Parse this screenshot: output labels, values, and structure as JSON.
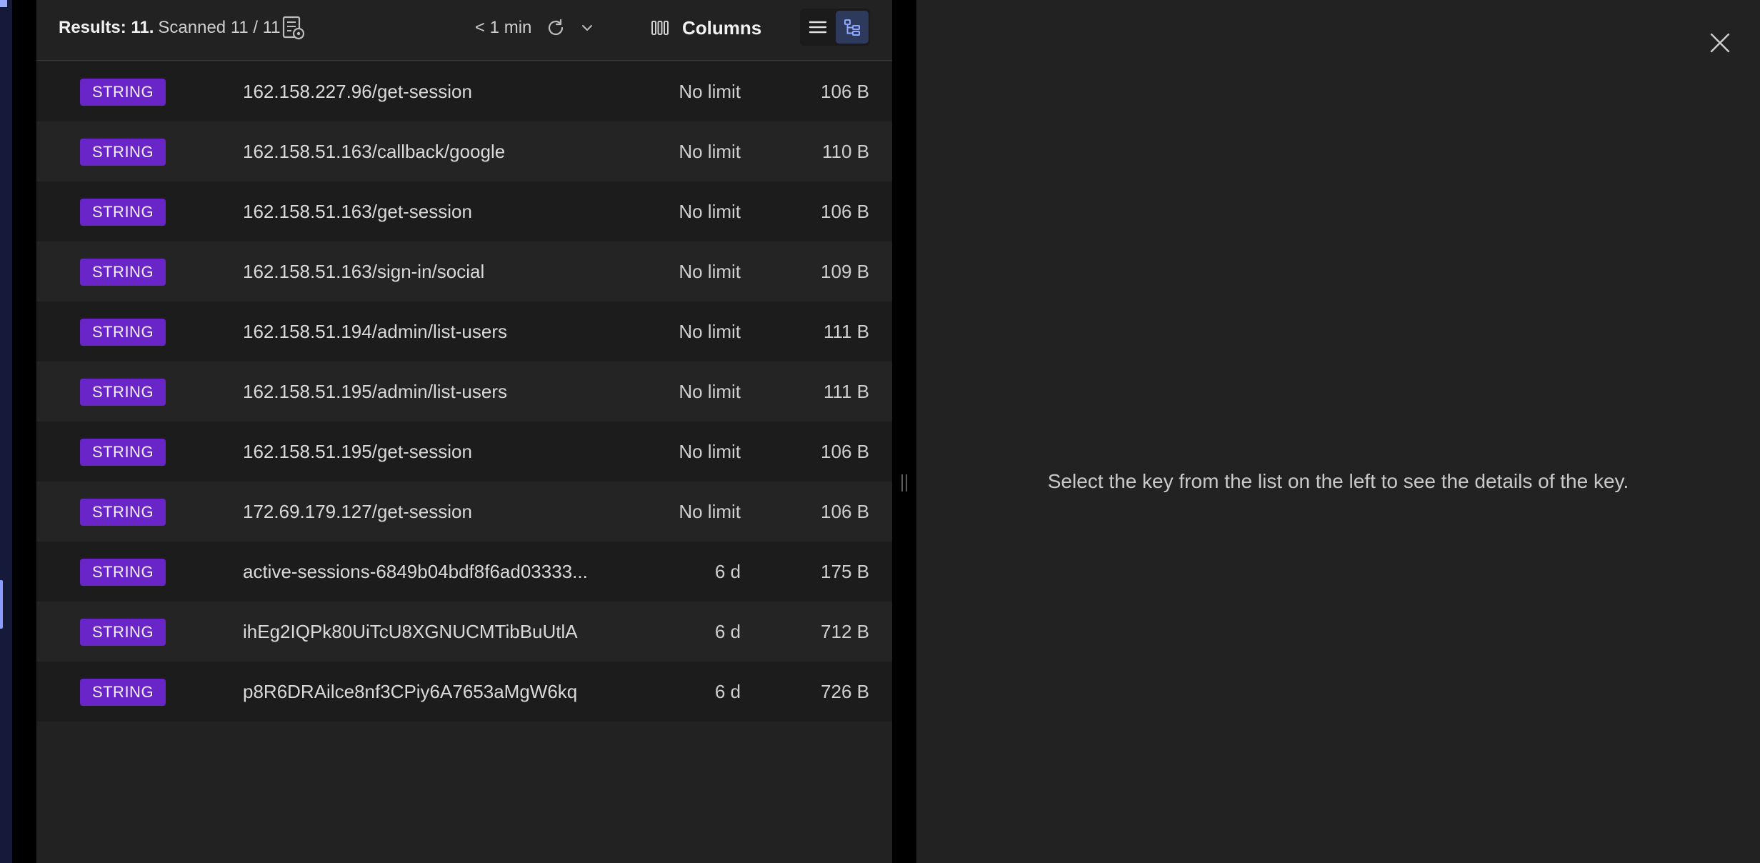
{
  "toolbar": {
    "results_label": "Results: 11.",
    "scanned_label": "Scanned 11 / 11",
    "refresh_time": "< 1 min",
    "columns_label": "Columns"
  },
  "rows": [
    {
      "type": "STRING",
      "key": "162.158.227.96/get-session",
      "ttl": "No limit",
      "size": "106 B"
    },
    {
      "type": "STRING",
      "key": "162.158.51.163/callback/google",
      "ttl": "No limit",
      "size": "110 B"
    },
    {
      "type": "STRING",
      "key": "162.158.51.163/get-session",
      "ttl": "No limit",
      "size": "106 B"
    },
    {
      "type": "STRING",
      "key": "162.158.51.163/sign-in/social",
      "ttl": "No limit",
      "size": "109 B"
    },
    {
      "type": "STRING",
      "key": "162.158.51.194/admin/list-users",
      "ttl": "No limit",
      "size": "111 B"
    },
    {
      "type": "STRING",
      "key": "162.158.51.195/admin/list-users",
      "ttl": "No limit",
      "size": "111 B"
    },
    {
      "type": "STRING",
      "key": "162.158.51.195/get-session",
      "ttl": "No limit",
      "size": "106 B"
    },
    {
      "type": "STRING",
      "key": "172.69.179.127/get-session",
      "ttl": "No limit",
      "size": "106 B"
    },
    {
      "type": "STRING",
      "key": "active-sessions-6849b04bdf8f6ad03333...",
      "ttl": "6 d",
      "size": "175 B"
    },
    {
      "type": "STRING",
      "key": "ihEg2IQPk80UiTcU8XGNUCMTibBuUtlA",
      "ttl": "6 d",
      "size": "712 B"
    },
    {
      "type": "STRING",
      "key": "p8R6DRAilce8nf3CPiy6A7653aMgW6kq",
      "ttl": "6 d",
      "size": "726 B"
    }
  ],
  "details": {
    "empty_message": "Select the key from the list on the left to see the details of the key."
  },
  "colors": {
    "type_badge": "#6a25c9",
    "panel_bg": "#222222",
    "active_view_toggle": "#2e3a5c"
  },
  "icons": {
    "scan_settings": "scan-settings-icon",
    "refresh": "refresh-icon",
    "refresh_options": "chevron-down-icon",
    "columns": "columns-icon",
    "list_view": "list-view-icon",
    "tree_view": "tree-view-icon",
    "close": "close-icon"
  }
}
